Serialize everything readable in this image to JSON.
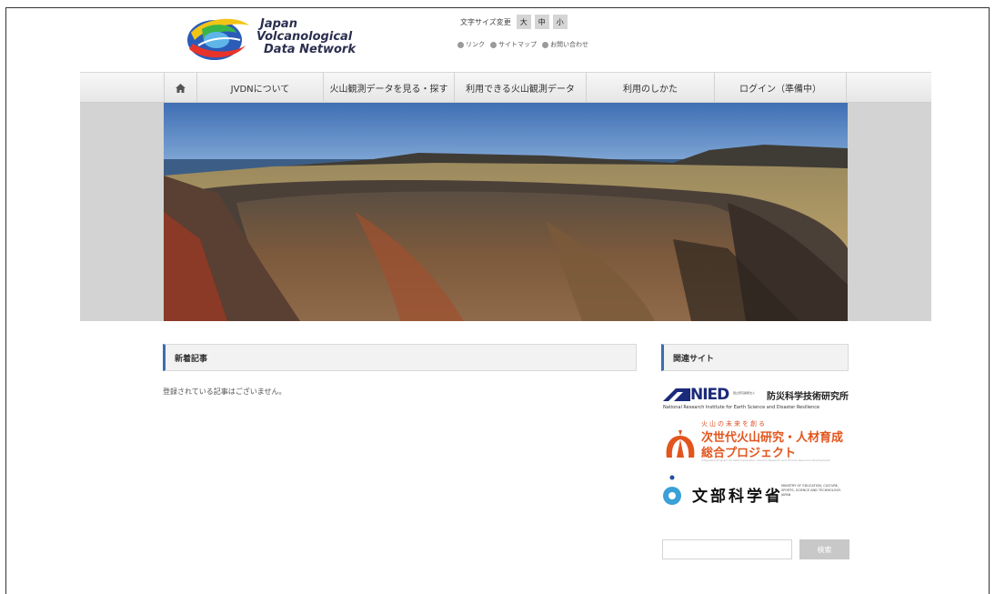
{
  "logo": {
    "line1": "Japan",
    "line2": "Volcanological",
    "line3": "Data Network",
    "icon": "jvdn-logo"
  },
  "font_size": {
    "label": "文字サイズ変更",
    "large": "大",
    "medium": "中",
    "small": "小"
  },
  "util_links": [
    {
      "label": "リンク"
    },
    {
      "label": "サイトマップ"
    },
    {
      "label": "お問い合わせ"
    }
  ],
  "nav": {
    "home_icon": "home-icon",
    "items": [
      {
        "label": "JVDNについて"
      },
      {
        "label": "火山観測データを見る・探す"
      },
      {
        "label": "利用できる火山観測データ"
      },
      {
        "label": "利用のしかた"
      },
      {
        "label": "ログイン（準備中）"
      }
    ]
  },
  "hero": {
    "image": "volcanic-crater-photo"
  },
  "news": {
    "title": "新着記事",
    "empty_message": "登録されている記事はございません。"
  },
  "related": {
    "title": "関連サイト",
    "nied": {
      "mark": "NIED",
      "small": "国立研究開発法人",
      "jp": "防災科学技術研究所",
      "en": "National Research Institute for Earth Science and Disaster Resilience"
    },
    "nextgen": {
      "kana": "火山の未来を創る",
      "line1": "次世代火山研究・人材育成",
      "line2": "総合プロジェクト",
      "en": "Integrated Program for Next Generation Volcano Research and Human Resource Development"
    },
    "mext": {
      "jp": "文部科学省",
      "en": "MINISTRY OF EDUCATION, CULTURE, SPORTS, SCIENCE AND TECHNOLOGY-JAPAN"
    }
  },
  "search": {
    "value": "",
    "button_label": "検索"
  },
  "colors": {
    "accent": "#3a6fb0",
    "logo_text": "#2b2f4f",
    "orange": "#e2551d",
    "nied_blue": "#1b2a7a"
  }
}
